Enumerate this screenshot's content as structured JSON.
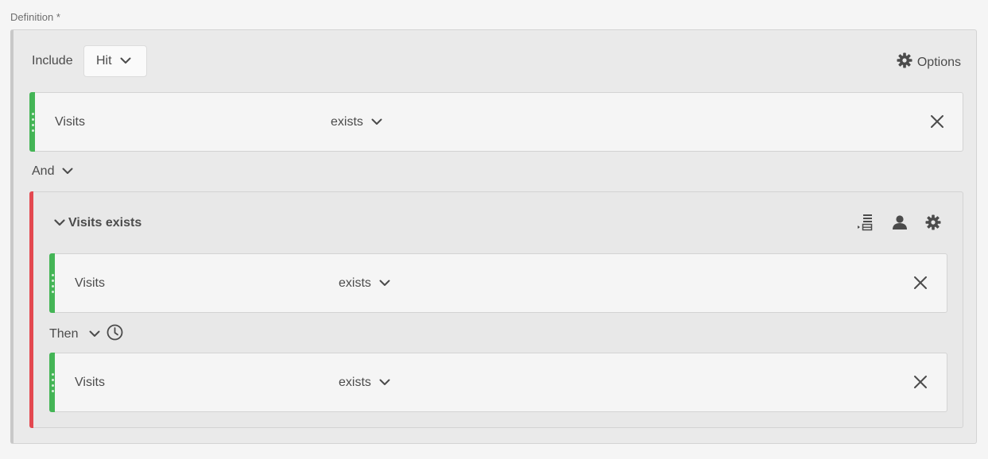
{
  "definition_label": "Definition",
  "required_marker": "*",
  "header": {
    "include_label": "Include",
    "scope_dropdown": {
      "selected": "Hit",
      "icon": "chevron-down-icon"
    },
    "options_label": "Options",
    "options_icon": "gear-icon"
  },
  "top_rule": {
    "dimension": "Visits",
    "operator": "exists",
    "accent_color": "#44b556"
  },
  "and_operator": "And",
  "group": {
    "title": "Visits exists",
    "accent_color": "#e34850",
    "tools": [
      "sequence-list-icon",
      "user-icon",
      "gear-icon"
    ],
    "rules": [
      {
        "dimension": "Visits",
        "operator": "exists"
      },
      {
        "dimension": "Visits",
        "operator": "exists"
      }
    ],
    "then_label": "Then",
    "then_icon": "clock-icon"
  }
}
